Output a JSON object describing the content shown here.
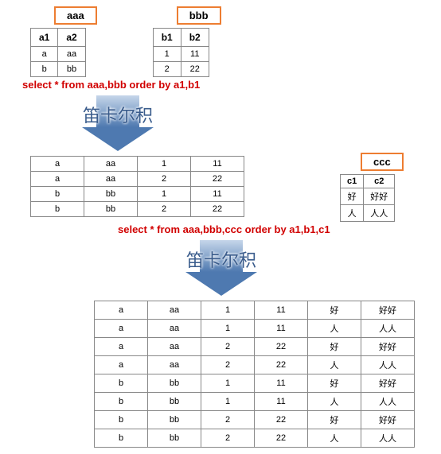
{
  "tables": {
    "aaa": {
      "label": "aaa",
      "headers": [
        "a1",
        "a2"
      ],
      "rows": [
        [
          "a",
          "aa"
        ],
        [
          "b",
          "bb"
        ]
      ]
    },
    "bbb": {
      "label": "bbb",
      "headers": [
        "b1",
        "b2"
      ],
      "rows": [
        [
          "1",
          "11"
        ],
        [
          "2",
          "22"
        ]
      ]
    },
    "ccc": {
      "label": "ccc",
      "headers": [
        "c1",
        "c2"
      ],
      "rows": [
        [
          "好",
          "好好"
        ],
        [
          "人",
          "人人"
        ]
      ]
    }
  },
  "sql1": "select * from aaa,bbb order by a1,b1",
  "sql2": "select * from aaa,bbb,ccc order by a1,b1,c1",
  "arrow_label": "笛卡尔积",
  "result1": {
    "rows": [
      [
        "a",
        "aa",
        "1",
        "11"
      ],
      [
        "a",
        "aa",
        "2",
        "22"
      ],
      [
        "b",
        "bb",
        "1",
        "11"
      ],
      [
        "b",
        "bb",
        "2",
        "22"
      ]
    ]
  },
  "result2": {
    "rows": [
      [
        "a",
        "aa",
        "1",
        "11",
        "好",
        "好好"
      ],
      [
        "a",
        "aa",
        "1",
        "11",
        "人",
        "人人"
      ],
      [
        "a",
        "aa",
        "2",
        "22",
        "好",
        "好好"
      ],
      [
        "a",
        "aa",
        "2",
        "22",
        "人",
        "人人"
      ],
      [
        "b",
        "bb",
        "1",
        "11",
        "好",
        "好好"
      ],
      [
        "b",
        "bb",
        "1",
        "11",
        "人",
        "人人"
      ],
      [
        "b",
        "bb",
        "2",
        "22",
        "好",
        "好好"
      ],
      [
        "b",
        "bb",
        "2",
        "22",
        "人",
        "人人"
      ]
    ]
  }
}
